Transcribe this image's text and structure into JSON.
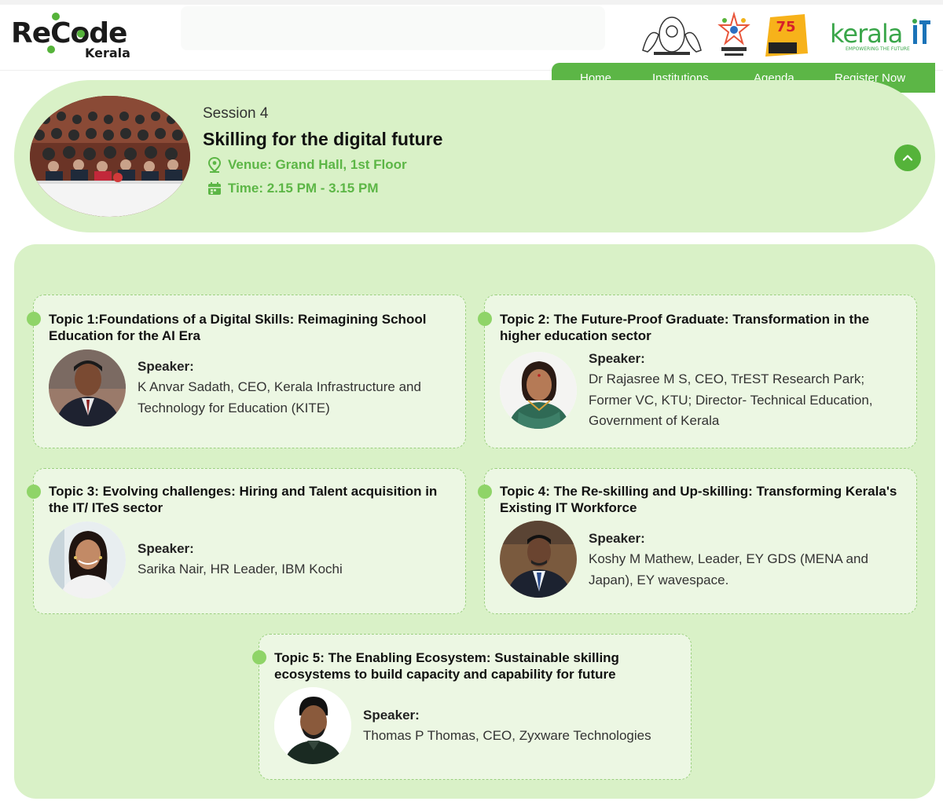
{
  "header": {
    "logo_main": "ReCode",
    "logo_sub": "Kerala",
    "keralait_text": "Kerala",
    "keralait_tagline": "EMPOWERING THE FUTURE",
    "nav": [
      {
        "label": "Home"
      },
      {
        "label": "Institutions"
      },
      {
        "label": "Agenda"
      },
      {
        "label": "Register Now"
      }
    ]
  },
  "session": {
    "label": "Session 4",
    "title": "Skilling for the digital future",
    "venue": "Venue: Grand Hall, 1st Floor",
    "time": "Time: 2.15 PM - 3.15 PM"
  },
  "topics": [
    {
      "title": "Topic 1:Foundations of a Digital Skills: Reimagining School Education for the AI Era",
      "speaker_label": "Speaker:",
      "speaker": "K Anvar Sadath, CEO, Kerala Infrastructure and Technology for Education (KITE)"
    },
    {
      "title": "Topic 2: The Future-Proof Graduate: Transformation in the higher education sector",
      "speaker_label": "Speaker:",
      "speaker": "Dr Rajasree M S, CEO, TrEST Research Park; Former VC, KTU; Director- Technical Education, Government of Kerala"
    },
    {
      "title": "Topic 3: Evolving challenges: Hiring and Talent acquisition in the IT/ ITeS sector",
      "speaker_label": "Speaker:",
      "speaker": "Sarika Nair, HR Leader, IBM Kochi"
    },
    {
      "title": "Topic 4: The Re-skilling and Up-skilling: Transforming Kerala's Existing IT Workforce",
      "speaker_label": "Speaker:",
      "speaker": "Koshy M Mathew, Leader, EY GDS (MENA and Japan), EY wavespace."
    },
    {
      "title": "Topic 5: The Enabling Ecosystem: Sustainable skilling ecosystems to build capacity and capability for future",
      "speaker_label": "Speaker:",
      "speaker": "Thomas P Thomas, CEO, Zyxware Technologies"
    }
  ],
  "colors": {
    "accent": "#5cb646",
    "panel": "#d9f1c7",
    "card": "#ecf7e3"
  }
}
